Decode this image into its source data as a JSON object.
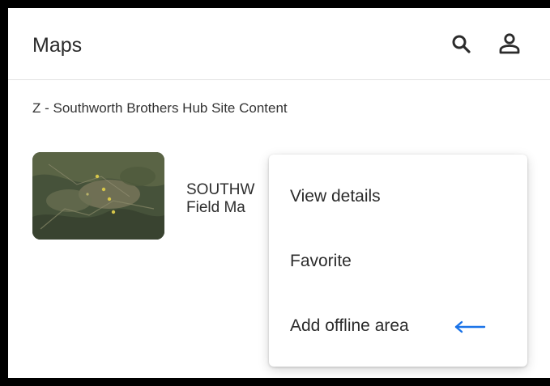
{
  "app_bar": {
    "title": "Maps",
    "search_icon": "search-icon",
    "profile_icon": "person-icon"
  },
  "section": {
    "label": "Z - Southworth Brothers Hub Site Content"
  },
  "map_item": {
    "title": "SOUTHW",
    "subtitle": "Field Ma",
    "thumbnail_icon": "map-thumbnail"
  },
  "menu": {
    "items": [
      {
        "label": "View details"
      },
      {
        "label": "Favorite"
      },
      {
        "label": "Add offline area"
      }
    ],
    "annotation_icon": "left-arrow-icon",
    "annotation_color": "#1a73e8"
  },
  "colors": {
    "frame_border": "#000000",
    "text_primary": "#2b2b2b",
    "divider": "#e3e3e3"
  }
}
